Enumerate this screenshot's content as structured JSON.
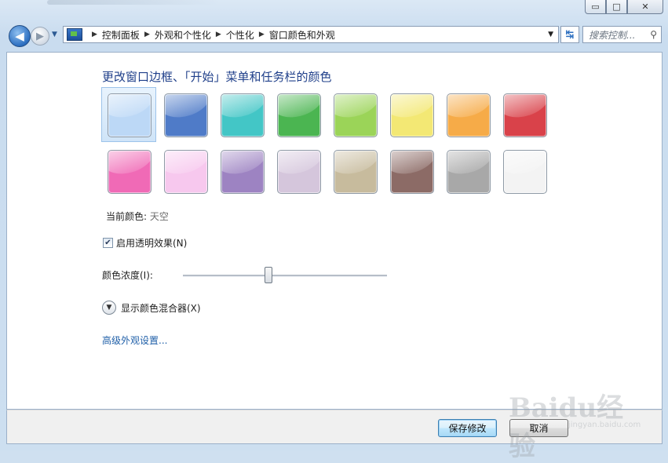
{
  "window": {
    "minimize_glyph": "▭",
    "maximize_glyph": "□",
    "close_glyph": "✕"
  },
  "nav": {
    "back_glyph": "◀",
    "forward_glyph": "▶",
    "breadcrumb": [
      "控制面板",
      "外观和个性化",
      "个性化",
      "窗口颜色和外观"
    ],
    "search_placeholder": "搜索控制...",
    "icons": {
      "control_panel": "control-panel-icon",
      "search": "search-icon",
      "refresh": "refresh-icon"
    }
  },
  "main": {
    "heading": "更改窗口边框、「开始」菜单和任务栏的颜色",
    "swatches_row1": [
      {
        "name": "sky",
        "color": "#bcd8f6",
        "selected": true
      },
      {
        "name": "twilight",
        "color": "#4f7bc8",
        "selected": false
      },
      {
        "name": "sea",
        "color": "#43c6c6",
        "selected": false
      },
      {
        "name": "leaf",
        "color": "#4bb551",
        "selected": false
      },
      {
        "name": "lime",
        "color": "#9bd458",
        "selected": false
      },
      {
        "name": "lemon",
        "color": "#f3e874",
        "selected": false
      },
      {
        "name": "pumpkin",
        "color": "#f6ab48",
        "selected": false
      },
      {
        "name": "ruby",
        "color": "#d9424a",
        "selected": false
      }
    ],
    "swatches_row2": [
      {
        "name": "fuchsia",
        "color": "#f06ab6",
        "selected": false
      },
      {
        "name": "blush",
        "color": "#f7c8ee",
        "selected": false
      },
      {
        "name": "violet",
        "color": "#9d83c2",
        "selected": false
      },
      {
        "name": "lavender",
        "color": "#d5c6dc",
        "selected": false
      },
      {
        "name": "taupe",
        "color": "#c7bb9d",
        "selected": false
      },
      {
        "name": "chocolate",
        "color": "#8c6b66",
        "selected": false
      },
      {
        "name": "slate",
        "color": "#a8a8a8",
        "selected": false
      },
      {
        "name": "frost",
        "color": "#f3f3f3",
        "selected": false
      }
    ],
    "current_label": "当前颜色:",
    "current_value": "天空",
    "transparency_label": "启用透明效果(N)",
    "transparency_checked": true,
    "intensity_label": "颜色浓度(I):",
    "intensity_value": 0.42,
    "mixer_label": "显示颜色混合器(X)",
    "advanced_link": "高级外观设置..."
  },
  "footer": {
    "save_label": "保存修改",
    "cancel_label": "取消"
  },
  "watermark": {
    "brand": "Baidu经验",
    "url": "jingyan.baidu.com"
  }
}
